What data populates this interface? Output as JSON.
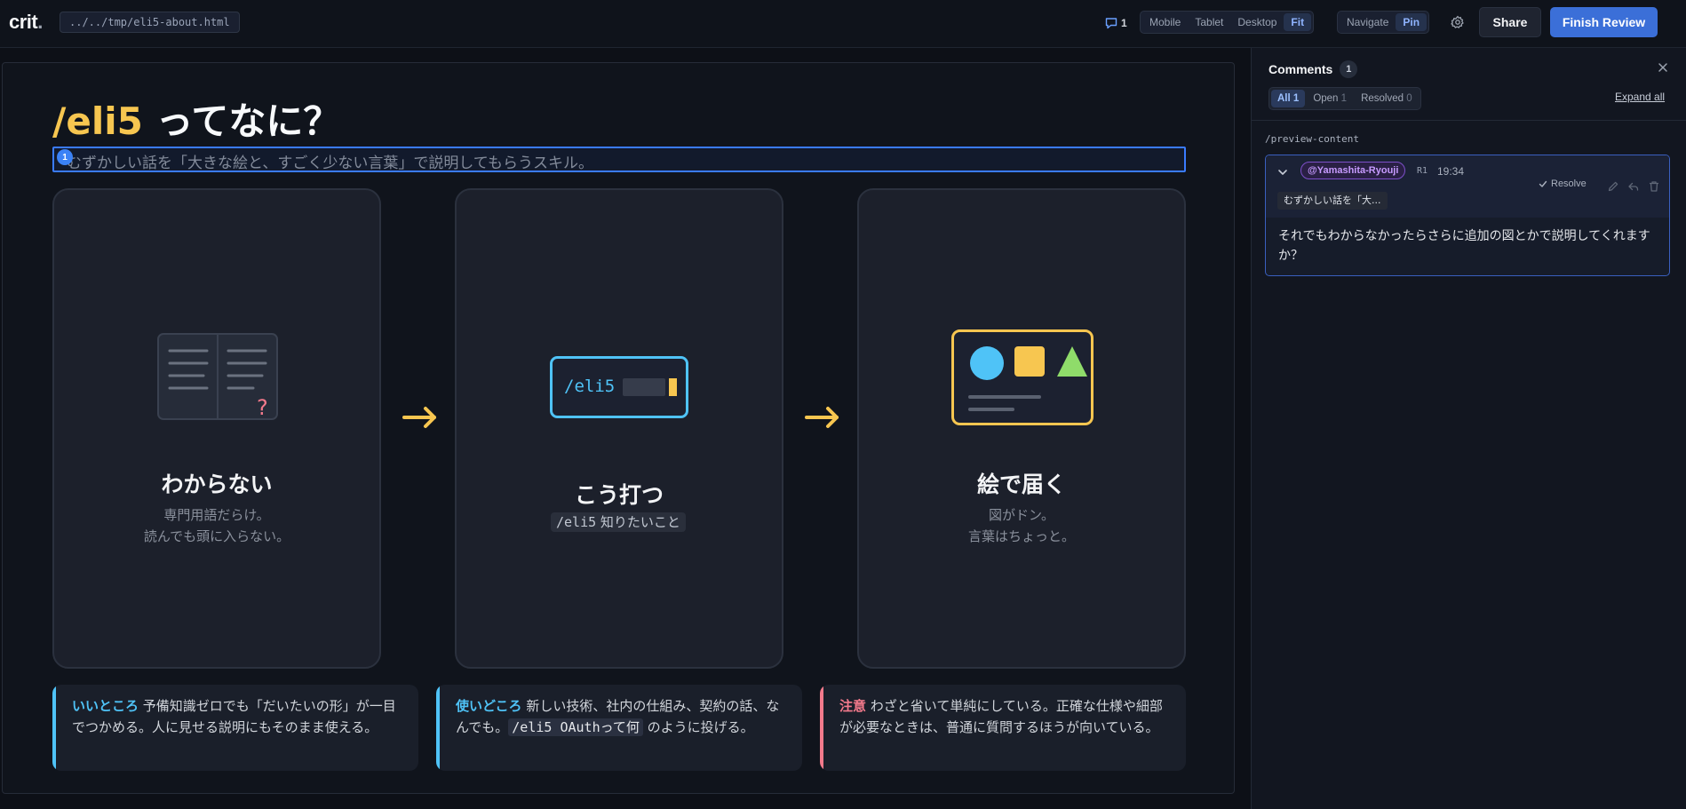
{
  "app": {
    "logo": "crit",
    "logo_dot": ".",
    "file_path": "../../tmp/eli5-about.html"
  },
  "toolbar": {
    "comment_count": "1",
    "device_options": [
      "Mobile",
      "Tablet",
      "Desktop",
      "Fit"
    ],
    "device_selected": "Fit",
    "mode_options": [
      "Navigate",
      "Pin"
    ],
    "mode_selected": "Pin",
    "share_label": "Share",
    "finish_label": "Finish Review",
    "accent_color": "#3b6fd8"
  },
  "preview": {
    "title_accent": "/eli5",
    "title_rest": " ってなに？",
    "subtitle": "むずかしい話を「大きな絵と、すごく少ない言葉」で説明してもらうスキル。",
    "pin_number": "1",
    "cards": [
      {
        "icon": "open-book-icon",
        "heading": "わからない",
        "desc_line1": "専門用語だらけ。",
        "desc_line2": "読んでも頭に入らない。"
      },
      {
        "icon": "terminal-icon",
        "heading": "こう打つ",
        "terminal_text": "/eli5",
        "code_cmd": "/eli5",
        "code_rest": " 知りたいこと"
      },
      {
        "icon": "picture-shapes-icon",
        "heading": "絵で届く",
        "desc_line1": "図がドン。",
        "desc_line2": "言葉はちょっと。"
      }
    ],
    "notes": [
      {
        "label": "いいところ",
        "text": " 予備知識ゼロでも「だいたいの形」が一目でつかめる。人に見せる説明にもそのまま使える。",
        "color": "#4fc3f7"
      },
      {
        "label": "使いどころ",
        "text_before": " 新しい技術、社内の仕組み、契約の話、なんでも。",
        "code": "/eli5 OAuthって何",
        "text_after": " のように投げる。",
        "color": "#4fc3f7"
      },
      {
        "label": "注意",
        "text": " わざと省いて単純にしている。正確な仕様や細部が必要なときは、普通に質問するほうが向いている。",
        "color": "#f47a8c"
      }
    ]
  },
  "sidebar": {
    "title": "Comments",
    "count": "1",
    "filters": [
      {
        "label": "All",
        "count": "1"
      },
      {
        "label": "Open",
        "count": "1"
      },
      {
        "label": "Resolved",
        "count": "0"
      }
    ],
    "filter_selected": "All",
    "expand_label": "Expand all",
    "file": "/preview-content",
    "thread": {
      "author": "@Yamashita-Ryouji",
      "revision": "R1",
      "time": "19:34",
      "quote": "むずかしい話を「大...",
      "resolve_label": "Resolve",
      "body": "それでもわからなかったらさらに追加の図とかで説明してくれますか？"
    }
  }
}
